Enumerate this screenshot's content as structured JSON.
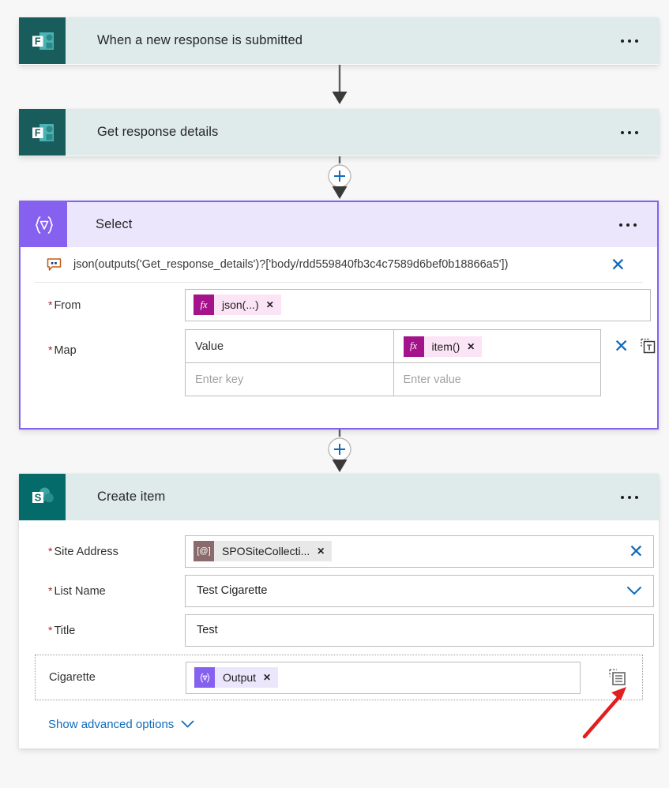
{
  "flow": {
    "steps": [
      {
        "id": "trigger",
        "title": "When a new response is submitted",
        "icon": "microsoft-forms-icon",
        "connector": "Microsoft Forms",
        "menu": "more-commands"
      },
      {
        "id": "get-response",
        "title": "Get response details",
        "icon": "microsoft-forms-icon",
        "connector": "Microsoft Forms",
        "menu": "more-commands"
      },
      {
        "id": "select",
        "title": "Select",
        "icon": "select-data-operation-icon",
        "connector": "Data Operation",
        "menu": "more-commands"
      },
      {
        "id": "create-item",
        "title": "Create item",
        "icon": "sharepoint-icon",
        "connector": "SharePoint",
        "menu": "more-commands"
      }
    ]
  },
  "select_action": {
    "comment_icon": "comment-icon",
    "expression": "json(outputs('Get_response_details')?['body/rdd559840fb3c4c7589d6bef0b18866a5'])",
    "expression_clear": "✕",
    "from": {
      "label": "From",
      "required": true,
      "token": {
        "icon_text": "fx",
        "label": "json(...)",
        "remove": "✕"
      }
    },
    "map": {
      "label": "Map",
      "required": true,
      "rows": [
        {
          "key": "Value",
          "key_placeholder": "Enter key",
          "value_token": {
            "icon_text": "fx",
            "label": "item()",
            "remove": "✕"
          }
        },
        {
          "key": "",
          "key_placeholder": "Enter key",
          "value": "",
          "value_placeholder": "Enter value"
        }
      ],
      "clear_label": "✕",
      "switch_mode_icon": "switch-to-text-mode-icon"
    }
  },
  "create_item_action": {
    "fields": [
      {
        "label": "Site Address",
        "required": true,
        "type": "token",
        "token": {
          "icon_text": "[@]",
          "label": "SPOSiteCollecti...",
          "remove": "✕"
        },
        "clear_label": "✕"
      },
      {
        "label": "List Name",
        "required": true,
        "type": "dropdown",
        "value": "Test Cigarette",
        "chevron": "chevron-down-icon"
      },
      {
        "label": "Title",
        "required": true,
        "type": "text",
        "value": "Test"
      },
      {
        "label": "Cigarette",
        "required": false,
        "type": "token",
        "token": {
          "icon_text": "{∇}",
          "label": "Output",
          "remove": "✕"
        },
        "array_icon": "switch-to-array-input-icon"
      }
    ],
    "advanced": {
      "label": "Show advanced options",
      "chevron": "chevron-down-icon"
    }
  },
  "annotation": {
    "arrow": "red-pointer-arrow",
    "color": "#e02020"
  },
  "colors": {
    "teal_header": "#dfeaea",
    "purple_header": "#ece6fd",
    "forms_icon_bg": "#185c5c",
    "sharepoint_icon_bg": "#046a6a",
    "select_icon_bg": "#8661f0",
    "accent_blue": "#0f6cbd",
    "required_red": "#a4262c"
  }
}
